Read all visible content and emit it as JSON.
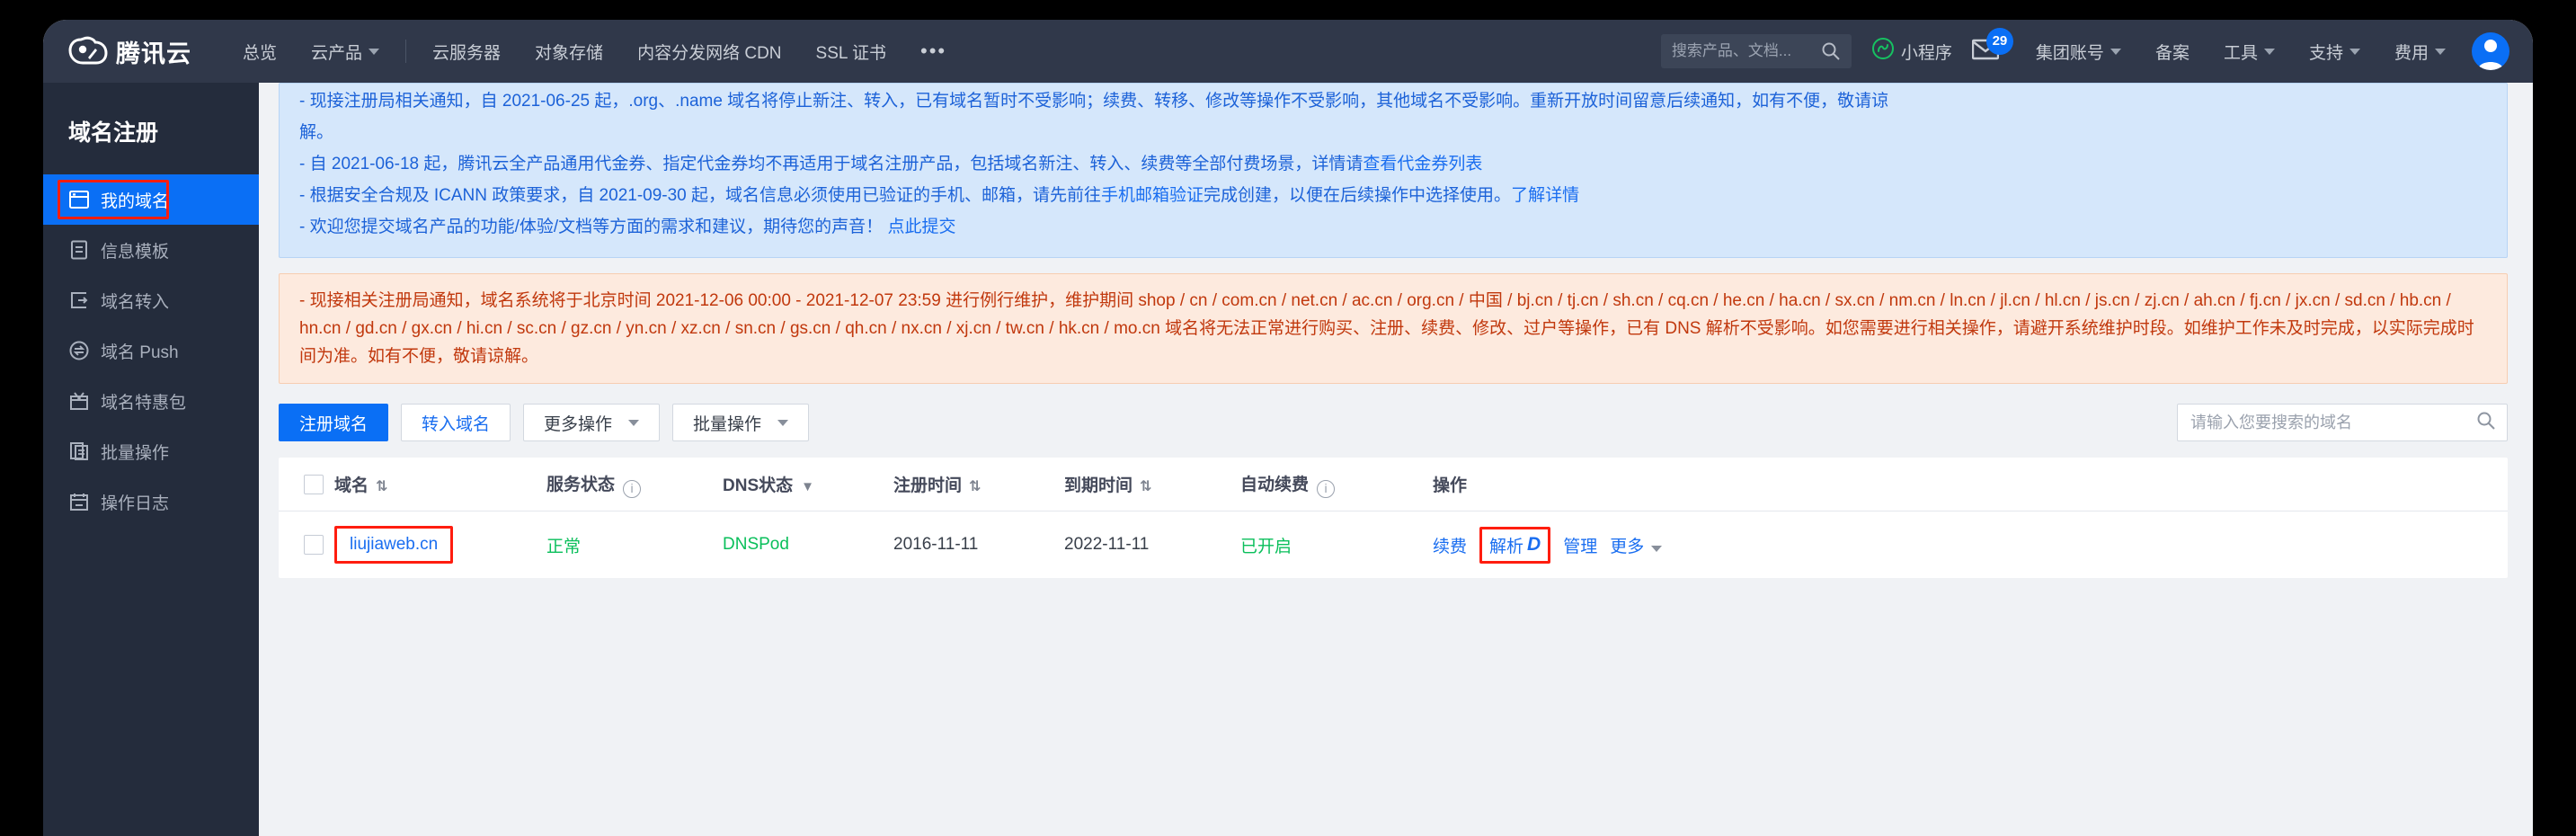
{
  "header": {
    "brand": "腾讯云",
    "nav": [
      {
        "label": "总览",
        "caret": false
      },
      {
        "label": "云产品",
        "caret": true
      },
      {
        "label": "云服务器",
        "caret": false
      },
      {
        "label": "对象存储",
        "caret": false
      },
      {
        "label": "内容分发网络 CDN",
        "caret": false
      },
      {
        "label": "SSL 证书",
        "caret": false
      }
    ],
    "more_dots": "•••",
    "search_placeholder": "搜索产品、文档...",
    "miniprogram": "小程序",
    "mail_badge": "29",
    "right_nav": [
      {
        "label": "集团账号",
        "caret": true
      },
      {
        "label": "备案",
        "caret": false
      },
      {
        "label": "工具",
        "caret": true
      },
      {
        "label": "支持",
        "caret": true
      },
      {
        "label": "费用",
        "caret": true
      }
    ]
  },
  "sidebar": {
    "title": "域名注册",
    "items": [
      {
        "label": "我的域名",
        "icon": "window-icon",
        "active": true
      },
      {
        "label": "信息模板",
        "icon": "document-icon",
        "active": false
      },
      {
        "label": "域名转入",
        "icon": "transfer-in-icon",
        "active": false
      },
      {
        "label": "域名 Push",
        "icon": "push-circle-icon",
        "active": false
      },
      {
        "label": "域名特惠包",
        "icon": "gift-icon",
        "active": false
      },
      {
        "label": "批量操作",
        "icon": "copy-icon",
        "active": false
      },
      {
        "label": "操作日志",
        "icon": "calendar-icon",
        "active": false
      }
    ]
  },
  "notice": {
    "line1": "- 现接注册局相关通知，自 2021-06-25 起，.org、.name 域名将停止新注、转入，已有域名暂时不受影响；续费、转移、修改等操作不受影响，其他域名不受影响。重新开放时间留意后续通知，如有不便，敬请谅",
    "line1b": "解。",
    "line2_pre": "- 自 2021-06-18 起，腾讯云全产品通用代金券、指定代金券均不再适用于域名注册产品，包括域名新注、转入、续费等全部付费场景，详情请",
    "line2_link": "查看代金券列表",
    "line3_pre": "- 根据安全合规及 ICANN 政策要求，自 2021-09-30 起，域名信息必须使用已验证的手机、邮箱，请先前往",
    "line3_link1": "手机邮箱验证",
    "line3_mid": "完成创建，以便在后续操作中选择使用。",
    "line3_link2": "了解详情",
    "line4_pre": "- 欢迎您提交域名产品的功能/体验/文档等方面的需求和建议，期待您的声音！ ",
    "line4_link": "点此提交"
  },
  "warning": {
    "text": "- 现接相关注册局通知，域名系统将于北京时间 2021-12-06 00:00 - 2021-12-07 23:59 进行例行维护，维护期间 shop / cn / com.cn / net.cn / ac.cn / org.cn / 中国 / bj.cn / tj.cn / sh.cn / cq.cn / he.cn / ha.cn / sx.cn / nm.cn / ln.cn / jl.cn / hl.cn / js.cn / zj.cn / ah.cn / fj.cn / jx.cn / sd.cn / hb.cn / hn.cn / gd.cn / gx.cn / hi.cn / sc.cn / gz.cn / yn.cn / xz.cn / sn.cn / gs.cn / qh.cn / nx.cn / xj.cn / tw.cn / hk.cn / mo.cn 域名将无法正常进行购买、注册、续费、修改、过户等操作，已有 DNS 解析不受影响。如您需要进行相关操作，请避开系统维护时段。如维护工作未及时完成，以实际完成时间为准。如有不便，敬请谅解。"
  },
  "toolbar": {
    "register_label": "注册域名",
    "transfer_label": "转入域名",
    "more_ops_label": "更多操作",
    "batch_ops_label": "批量操作",
    "search_placeholder": "请输入您要搜索的域名"
  },
  "table": {
    "columns": [
      {
        "label": "域名",
        "sort": true
      },
      {
        "label": "服务状态",
        "info": true
      },
      {
        "label": "DNS状态",
        "filter": true
      },
      {
        "label": "注册时间",
        "sort": true
      },
      {
        "label": "到期时间",
        "sort": true
      },
      {
        "label": "自动续费",
        "info": true
      },
      {
        "label": "操作"
      }
    ],
    "rows": [
      {
        "domain": "liujiaweb.cn",
        "service_status": "正常",
        "dns_status": "DNSPod",
        "register_time": "2016-11-11",
        "expire_time": "2022-11-11",
        "auto_renew": "已开启",
        "ops": [
          {
            "label": "续费",
            "highlight": false
          },
          {
            "label": "解析",
            "highlight": true,
            "suffix": "D"
          },
          {
            "label": "管理",
            "highlight": false
          },
          {
            "label": "更多",
            "highlight": false,
            "caret": true
          }
        ]
      }
    ]
  },
  "colors": {
    "accent": "#0a6ff5",
    "highlight_red": "#ff1d0f",
    "success_green": "#0abf5b",
    "notice_bg": "#d5e7fb",
    "warning_bg": "#fdeade",
    "warning_text": "#c1380d"
  }
}
